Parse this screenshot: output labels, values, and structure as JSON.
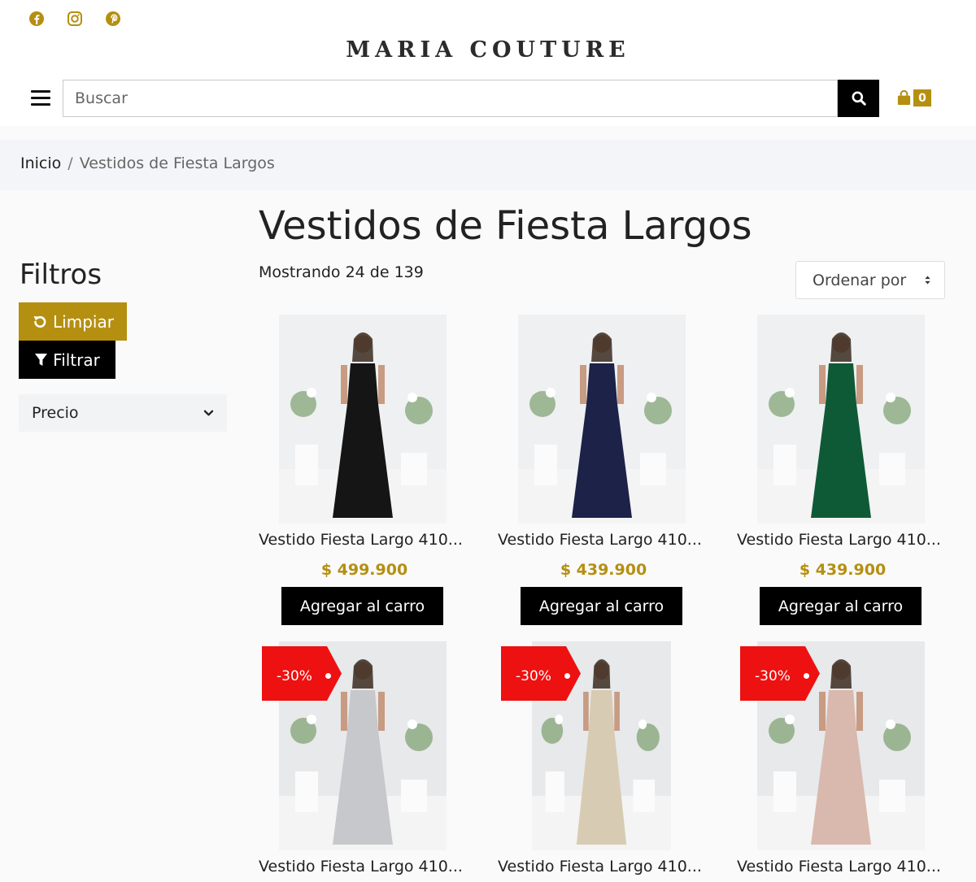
{
  "header": {
    "brand": "MARIA COUTURE",
    "social": [
      "facebook-icon",
      "instagram-icon",
      "pinterest-icon"
    ],
    "search_placeholder": "Buscar",
    "cart_count": "0",
    "accent_color": "#b58f10"
  },
  "breadcrumb": {
    "home": "Inicio",
    "separator": "/",
    "current": "Vestidos de Fiesta Largos"
  },
  "sidebar": {
    "title": "Filtros",
    "clear_label": "Limpiar",
    "filter_label": "Filtrar",
    "price_label": "Precio"
  },
  "main": {
    "title": "Vestidos de Fiesta Largos",
    "showing": "Mostrando 24 de 139",
    "sort_label": "Ordenar por"
  },
  "products": [
    {
      "name": "Vestido Fiesta Largo 410...",
      "price": "$ 499.900",
      "button": "Agregar al carro",
      "badge": "",
      "dress_color": "#151515"
    },
    {
      "name": "Vestido Fiesta Largo 410...",
      "price": "$ 439.900",
      "button": "Agregar al carro",
      "badge": "",
      "dress_color": "#1c2248"
    },
    {
      "name": "Vestido Fiesta Largo 410...",
      "price": "$ 439.900",
      "button": "Agregar al carro",
      "badge": "",
      "dress_color": "#0f5a36"
    },
    {
      "name": "Vestido Fiesta Largo 410...",
      "price": "",
      "button": "",
      "badge": "-30%",
      "dress_color": "#c6c8cb"
    },
    {
      "name": "Vestido Fiesta Largo 410...",
      "price": "",
      "button": "",
      "badge": "-30%",
      "dress_color": "#d8cbb3"
    },
    {
      "name": "Vestido Fiesta Largo 410...",
      "price": "",
      "button": "",
      "badge": "-30%",
      "dress_color": "#d9b9ad"
    }
  ]
}
